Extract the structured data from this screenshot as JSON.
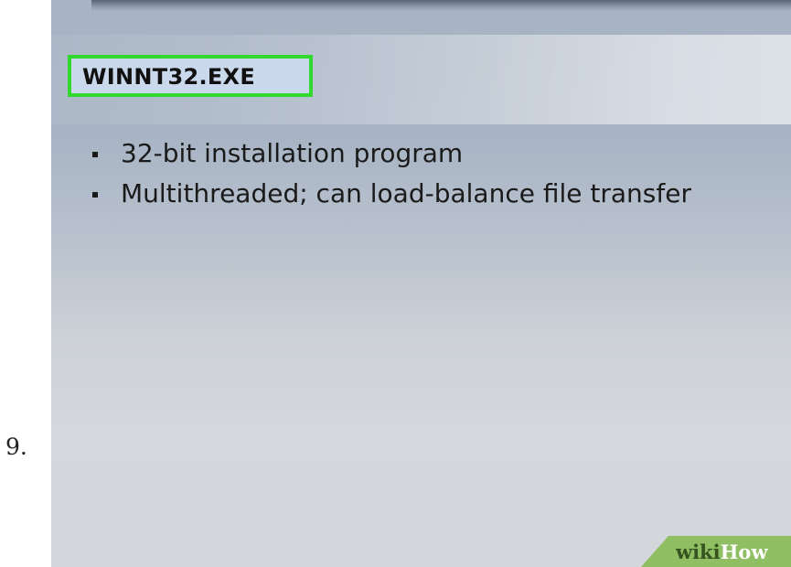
{
  "step": {
    "number": "9."
  },
  "slide": {
    "title": "WINNT32.EXE",
    "bullets": [
      {
        "text": "32-bit installation program"
      },
      {
        "text": "Multithreaded; can load-balance file transfer"
      }
    ]
  },
  "watermark": {
    "wiki": "wiki",
    "how": "How"
  },
  "colors": {
    "title_highlight_border": "#31d92f",
    "title_box_fill": "#c9d8ea",
    "watermark_green": "#8fbf62"
  }
}
